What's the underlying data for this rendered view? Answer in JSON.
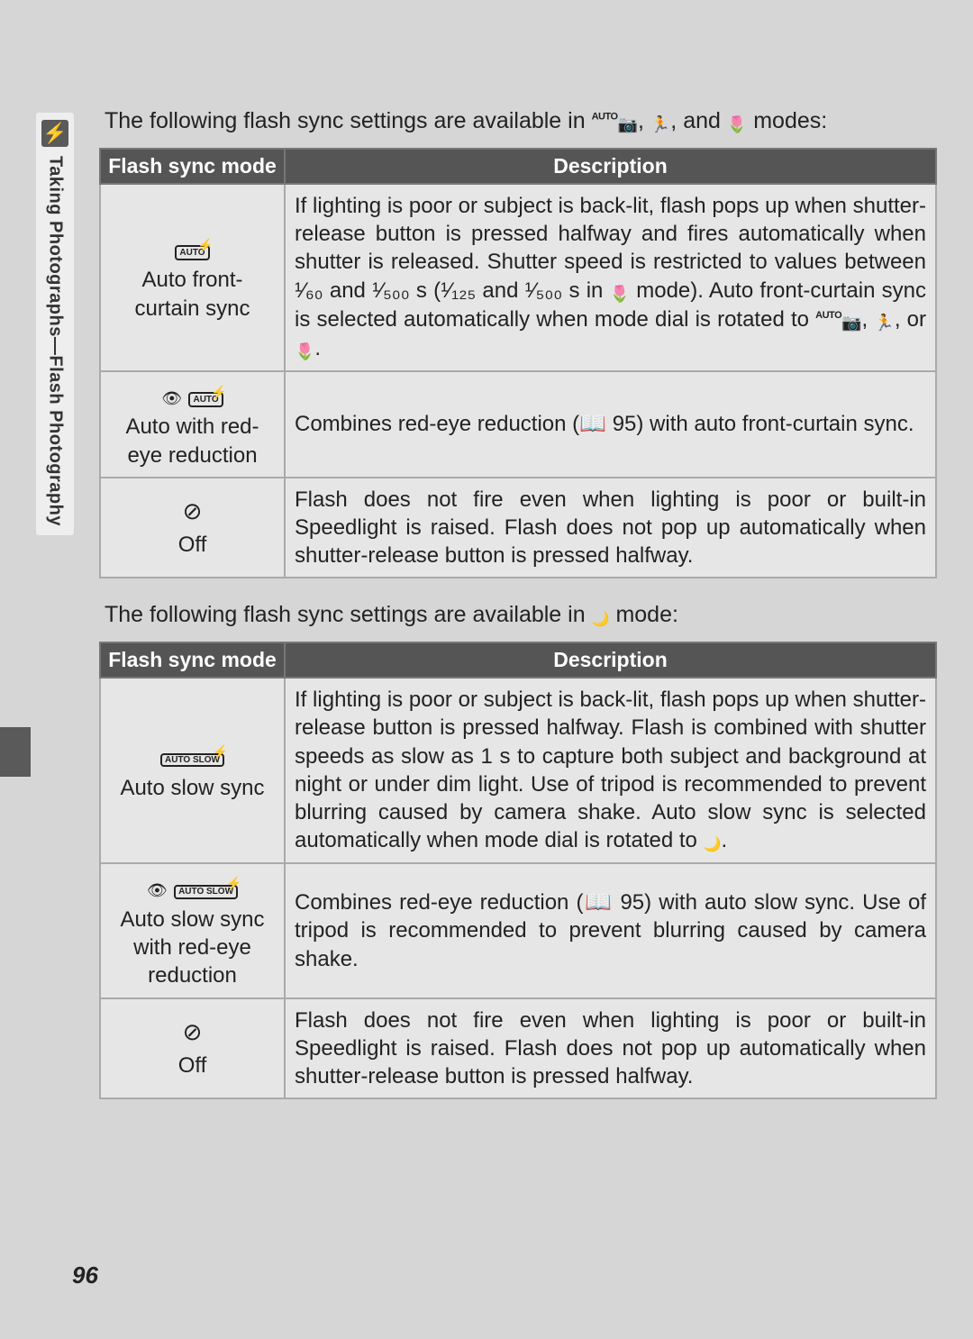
{
  "sidebar": {
    "icon": "⚡",
    "label": "Taking Photographs—Flash Photography"
  },
  "intro1_pre": "The following flash sync settings are available in ",
  "intro1_post": " modes:",
  "intro2_pre": "The following flash sync settings are available in ",
  "intro2_post": " mode:",
  "headers": {
    "mode": "Flash sync mode",
    "desc": "Description"
  },
  "table1": {
    "rows": [
      {
        "iconText": "AUTO",
        "label": "Auto front-curtain sync",
        "desc_pre": "If lighting is poor or subject is back-lit, flash pops up when shutter-release button is pressed halfway and fires automatically when shutter is released.  Shutter speed is restricted to values between ¹⁄₆₀ and ¹⁄₅₀₀ s (¹⁄₁₂₅ and ¹⁄₅₀₀ s in ",
        "desc_mid": " mode).  Auto front-curtain sync is selected automatically when mode dial is rotated to ",
        "desc_post": "."
      },
      {
        "iconText": "AUTO",
        "label": "Auto with red-eye reduction",
        "desc": "Combines red-eye reduction (📖 95) with auto front-curtain sync."
      },
      {
        "iconText": "⊘",
        "label": "Off",
        "desc": "Flash does not fire even when lighting is poor or built-in Speedlight is raised.  Flash does not pop up automatically when shutter-release button is pressed halfway."
      }
    ]
  },
  "table2": {
    "rows": [
      {
        "iconText": "AUTO SLOW",
        "label": "Auto slow sync",
        "desc_pre": "If lighting is poor or subject is back-lit, flash pops up when shutter-release button is pressed halfway.  Flash is combined with shutter speeds as slow as 1 s to capture both subject and background at night or under dim light.  Use of tripod is recommended to prevent blurring caused by camera shake.  Auto slow sync is selected automatically when mode dial is rotated to ",
        "desc_post": "."
      },
      {
        "iconText": "AUTO SLOW",
        "label": "Auto slow sync with red-eye reduction",
        "desc": "Combines red-eye reduction (📖 95) with auto slow sync.  Use of tripod is recommended to prevent blurring caused by camera shake."
      },
      {
        "iconText": "⊘",
        "label": "Off",
        "desc": "Flash does not fire even when lighting is poor or built-in Speedlight is raised.  Flash does not pop up automatically when shutter-release button is pressed halfway."
      }
    ]
  },
  "pageNumber": "96"
}
